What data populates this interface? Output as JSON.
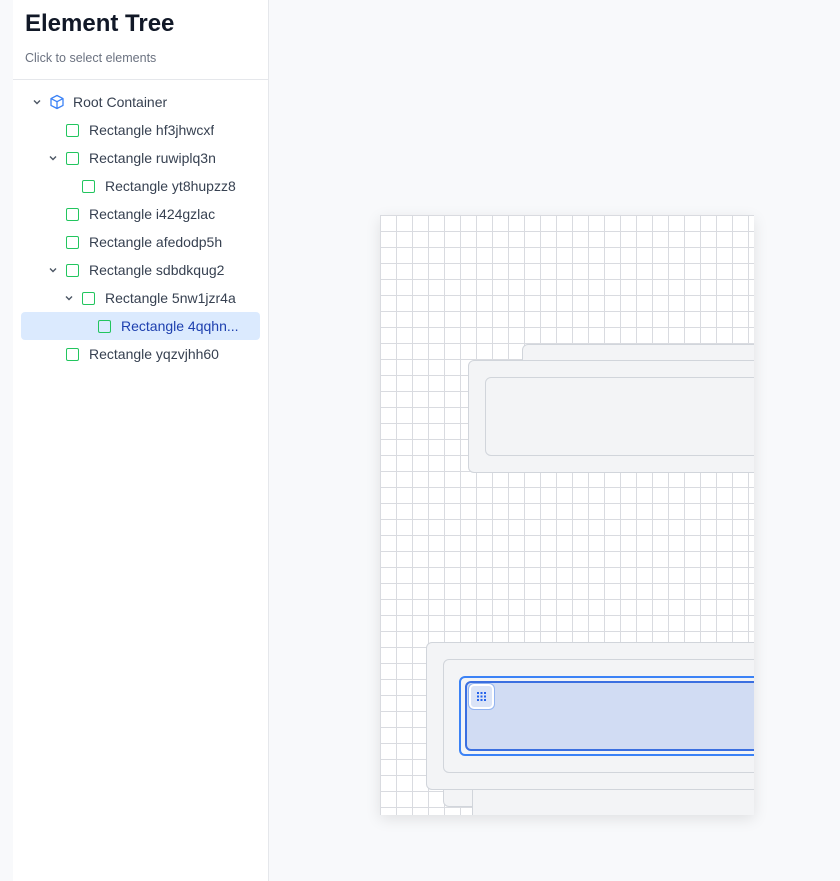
{
  "sidebar": {
    "title": "Element Tree",
    "subtitle": "Click to select elements",
    "items": [
      {
        "label": "Root Container",
        "depth": 0,
        "icon": "cube-icon",
        "expanded": true,
        "selected": false
      },
      {
        "label": "Rectangle hf3jhwcxf",
        "depth": 1,
        "icon": "rectangle-icon",
        "expanded": null,
        "selected": false
      },
      {
        "label": "Rectangle ruwiplq3n",
        "depth": 1,
        "icon": "rectangle-icon",
        "expanded": true,
        "selected": false
      },
      {
        "label": "Rectangle yt8hupzz8",
        "depth": 2,
        "icon": "rectangle-icon",
        "expanded": null,
        "selected": false
      },
      {
        "label": "Rectangle i424gzlac",
        "depth": 1,
        "icon": "rectangle-icon",
        "expanded": null,
        "selected": false
      },
      {
        "label": "Rectangle afedodp5h",
        "depth": 1,
        "icon": "rectangle-icon",
        "expanded": null,
        "selected": false
      },
      {
        "label": "Rectangle sdbdkqug2",
        "depth": 1,
        "icon": "rectangle-icon",
        "expanded": true,
        "selected": false
      },
      {
        "label": "Rectangle 5nw1jzr4a",
        "depth": 2,
        "icon": "rectangle-icon",
        "expanded": true,
        "selected": false
      },
      {
        "label": "Rectangle 4qqhn...",
        "depth": 3,
        "icon": "rectangle-icon",
        "expanded": null,
        "selected": true
      },
      {
        "label": "Rectangle yqzvjhh60",
        "depth": 1,
        "icon": "rectangle-icon",
        "expanded": null,
        "selected": false
      }
    ]
  },
  "colors": {
    "accent": "#3b82f6",
    "selected_row_bg": "#dbeafe",
    "rectangle_icon": "#22c55e",
    "grid_line": "#d9dbe0"
  },
  "canvas": {
    "handle_icon": "grip-dots-icon"
  }
}
